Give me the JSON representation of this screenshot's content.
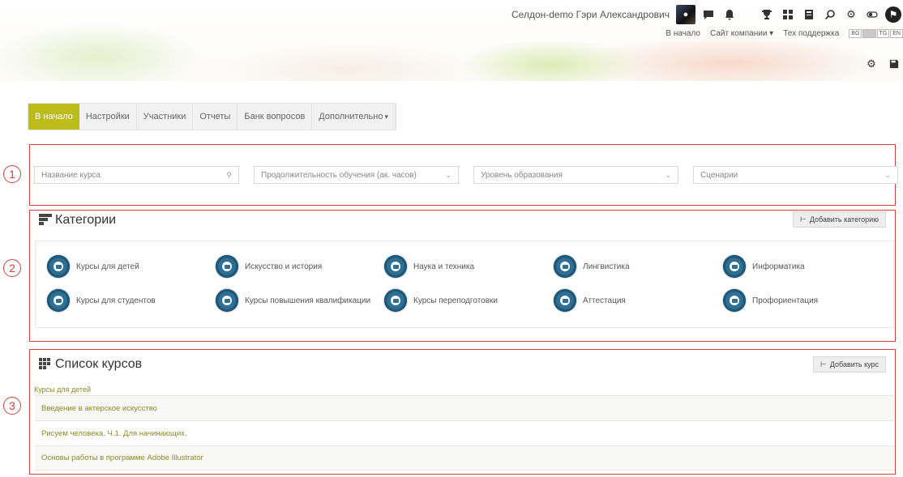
{
  "header": {
    "username": "Селдон-demo Гэри Александрович",
    "links": [
      {
        "label": "В начало",
        "dropdown": false
      },
      {
        "label": "Сайт компании",
        "dropdown": true
      },
      {
        "label": "Тех поддержка",
        "dropdown": false
      }
    ],
    "languages": [
      "BG",
      "RU",
      "TG",
      "EN"
    ],
    "active_language": "RU"
  },
  "nav": {
    "tabs": [
      "В начало",
      "Настройки",
      "Участники",
      "Отчеты",
      "Банк вопросов",
      "Дополнительно"
    ],
    "active_tab": "В начало"
  },
  "callouts": [
    "1",
    "2",
    "3"
  ],
  "filters": {
    "course_name_placeholder": "Название курса",
    "duration": "Продолжительность обучения (ак. часов)",
    "level": "Уровень образования",
    "scenarios": "Сценарии"
  },
  "categories": {
    "title": "Категории",
    "add_button": "Добавить категорию",
    "items": [
      "Курсы для детей",
      "Искусство и история",
      "Наука и техника",
      "Лингвистика",
      "Информатика",
      "Курсы для студентов",
      "Курсы повышения квалификации",
      "Курсы переподготовки",
      "Аттестация",
      "Профориентация"
    ]
  },
  "courses": {
    "title": "Список курсов",
    "add_button": "Добавить курс",
    "category_label": "Курсы для детей",
    "items": [
      "Введение в актерское искусство",
      "Рисуем человека. Ч.1. Для начинающих.",
      "Основы работы в программе Adobe Illustrator"
    ]
  },
  "colors": {
    "accent": "#bdbd1a",
    "callout": "#d84040",
    "folder": "#2e6f95",
    "course_link": "#8a8a2a"
  }
}
